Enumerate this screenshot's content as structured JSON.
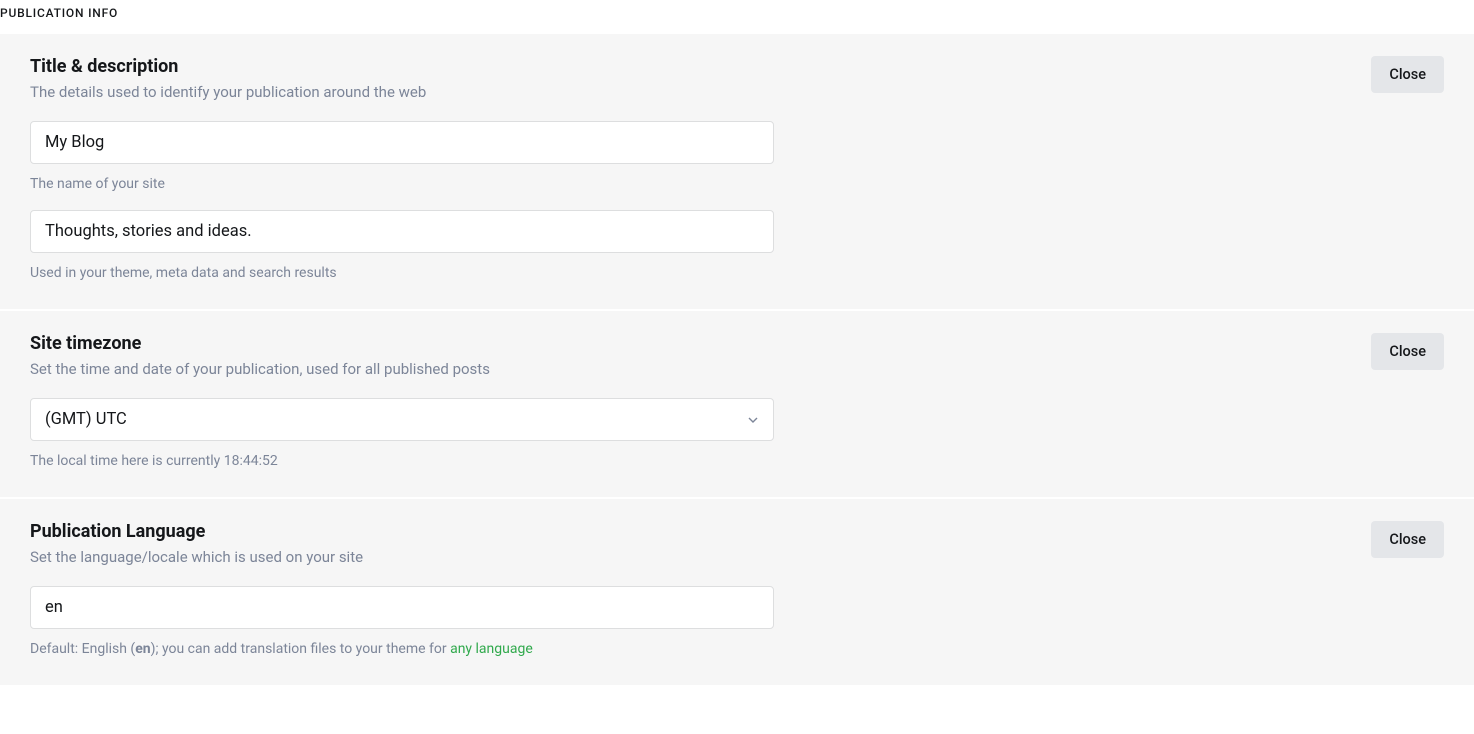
{
  "section_label": "PUBLICATION INFO",
  "title_desc": {
    "heading": "Title & description",
    "subheading": "The details used to identify your publication around the web",
    "close_label": "Close",
    "site_title_value": "My Blog",
    "site_title_help": "The name of your site",
    "site_desc_value": "Thoughts, stories and ideas.",
    "site_desc_help": "Used in your theme, meta data and search results"
  },
  "timezone": {
    "heading": "Site timezone",
    "subheading": "Set the time and date of your publication, used for all published posts",
    "close_label": "Close",
    "selected": "(GMT) UTC",
    "help": "The local time here is currently 18:44:52"
  },
  "language": {
    "heading": "Publication Language",
    "subheading": "Set the language/locale which is used on your site",
    "close_label": "Close",
    "value": "en",
    "help_prefix": "Default: English (",
    "help_bold": "en",
    "help_mid": "); you can add translation files to your theme for ",
    "help_link": "any language"
  }
}
